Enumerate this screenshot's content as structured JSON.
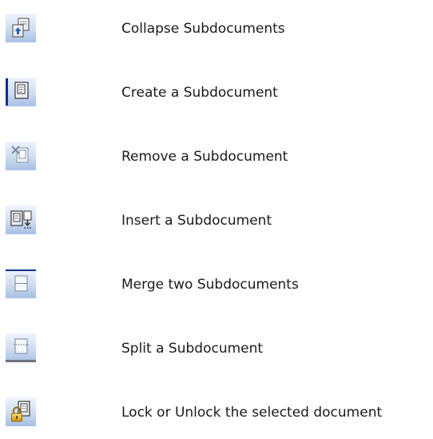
{
  "toolbar_buttons": [
    {
      "icon": "collapse-subdocuments-icon",
      "label": "Collapse Subdocuments"
    },
    {
      "icon": "create-subdocument-icon",
      "label": "Create a Subdocument"
    },
    {
      "icon": "remove-subdocument-icon",
      "label": "Remove a Subdocument"
    },
    {
      "icon": "insert-subdocument-icon",
      "label": "Insert a Subdocument"
    },
    {
      "icon": "merge-subdocuments-icon",
      "label": "Merge two Subdocuments"
    },
    {
      "icon": "split-subdocument-icon",
      "label": "Split a Subdocument"
    },
    {
      "icon": "lock-document-icon",
      "label": "Lock or Unlock the selected document"
    }
  ],
  "colors": {
    "button_gradient_top": "#eaf1fb",
    "button_gradient_bottom": "#a9c2e6",
    "selection_bar": "#0b2f8a",
    "icon_stroke": "#3a3a3a",
    "lock_gold": "#d8a21a",
    "arrow_blue": "#2d5fb8"
  }
}
